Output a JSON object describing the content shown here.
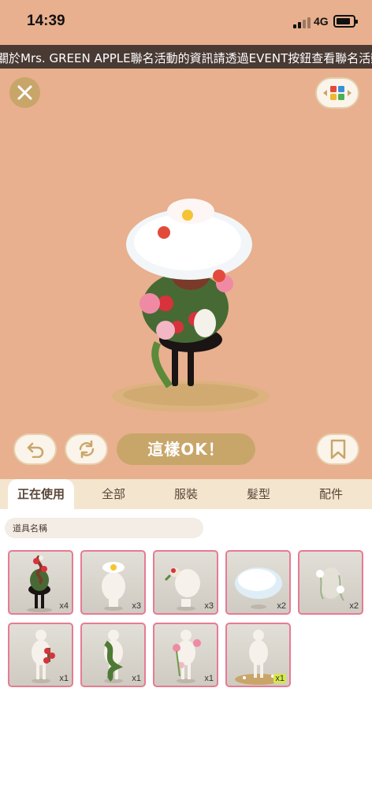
{
  "status_bar": {
    "time": "14:39",
    "network": "4G"
  },
  "marquee": {
    "text": "關於Mrs. GREEN APPLE聯名活動的資訊請透過EVENT按鈕查看聯名活動"
  },
  "actions": {
    "confirm_label": "這樣OK！"
  },
  "tabs": [
    {
      "label": "正在使用"
    },
    {
      "label": "全部"
    },
    {
      "label": "服裝"
    },
    {
      "label": "髮型"
    },
    {
      "label": "配件"
    }
  ],
  "search": {
    "placeholder": "道具名稱"
  },
  "items": [
    {
      "count": "x4",
      "icon": "rose-vine-dress-icon"
    },
    {
      "count": "x3",
      "icon": "daisy-hat-icon"
    },
    {
      "count": "x3",
      "icon": "flower-hair-clip-icon"
    },
    {
      "count": "x2",
      "icon": "cloud-hair-icon"
    },
    {
      "count": "x2",
      "icon": "white-flower-accessory-icon"
    },
    {
      "count": "x1",
      "icon": "cherry-top-icon"
    },
    {
      "count": "x1",
      "icon": "green-vine-wrap-icon"
    },
    {
      "count": "x1",
      "icon": "pink-rose-vine-icon"
    },
    {
      "count": "x1",
      "icon": "flower-ground-icon"
    }
  ],
  "colors": {
    "stage_bg": "#e8b08e",
    "accent_gold": "#c8a66a",
    "tab_bar": "#f4e5cf",
    "card_border": "#e77b93",
    "marquee_bg": "#4a3a34"
  }
}
